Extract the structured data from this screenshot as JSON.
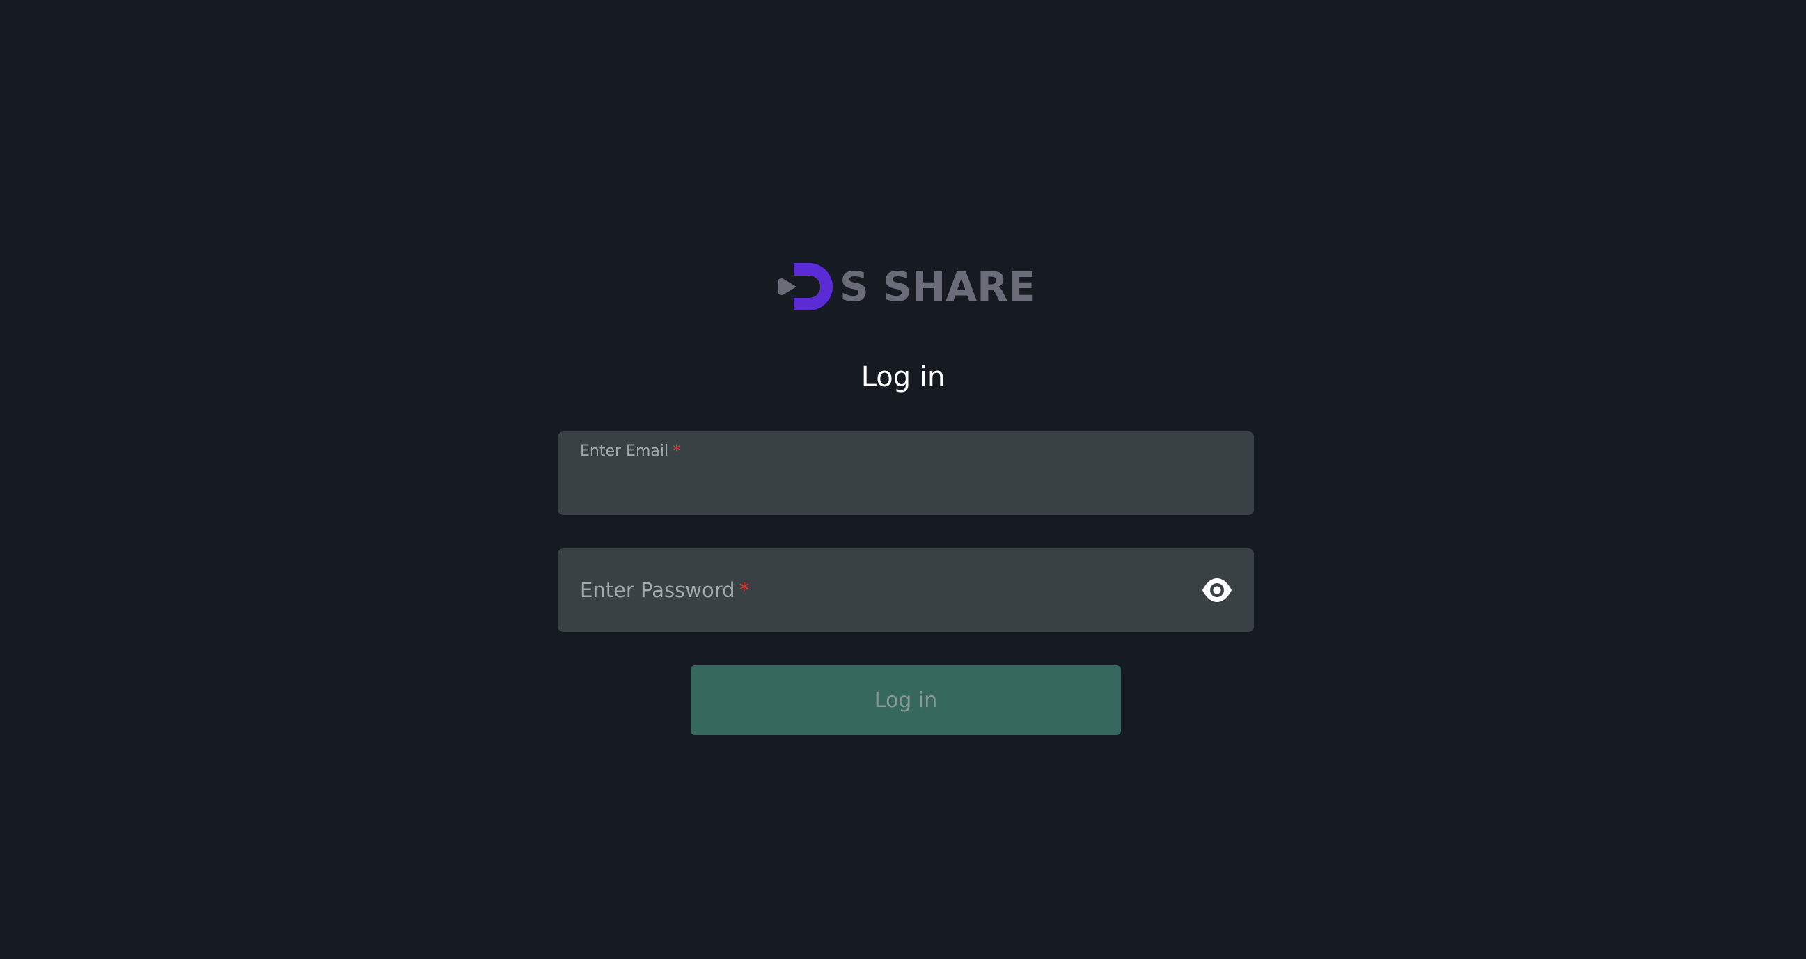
{
  "brand": {
    "name": "S SHARE",
    "logo_icon": "brand-logo-d",
    "accent_color": "#5b2bd6",
    "text_color": "#6a6c7a"
  },
  "page": {
    "title": "Log in",
    "background_color": "#151b21"
  },
  "form": {
    "email": {
      "label": "Enter Email",
      "required_mark": "*",
      "value": ""
    },
    "password": {
      "label": "Enter Password",
      "required_mark": "*",
      "value": "",
      "toggle_icon": "eye-icon"
    },
    "submit_label": "Log in",
    "submit_color": "#36685d"
  }
}
